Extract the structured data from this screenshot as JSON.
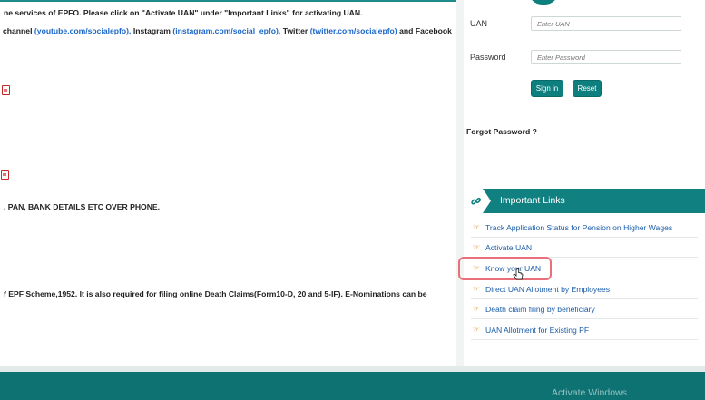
{
  "left": {
    "line1": "ne services of EPFO. Please click on \"Activate UAN\" under \"Important Links\" for activating UAN.",
    "line2": {
      "prefix": "channel",
      "youtube": "(youtube.com/socialepfo),",
      "instagram_label": "Instagram",
      "instagram": "(instagram.com/social_epfo),",
      "twitter_label": "Twitter",
      "twitter": "(twitter.com/socialepfo)",
      "and": "and",
      "facebook": "Facebook"
    },
    "line3": ", PAN, BANK DETAILS ETC OVER PHONE.",
    "line4": "f EPF Scheme,1952. It is also required for filing online Death Claims(Form10-D, 20 and 5-IF). E-Nominations can be"
  },
  "login": {
    "uan_label": "UAN",
    "uan_placeholder": "Enter UAN",
    "password_label": "Password",
    "password_placeholder": "Enter Password",
    "sign_in": "Sign in",
    "reset": "Reset",
    "forgot": "Forgot Password ?"
  },
  "important_links": {
    "title": "Important Links",
    "items": [
      "Track Application Status for Pension on Higher Wages",
      "Activate UAN",
      "Know your UAN",
      "Direct UAN Allotment by Employees",
      "Death claim filing by beneficiary",
      "UAN Allotment for Existing PF"
    ]
  },
  "watermark": "Activate Windows",
  "colors": {
    "teal": "#0d7f7f",
    "link": "#1a5ca8",
    "highlight": "#e8707a"
  }
}
